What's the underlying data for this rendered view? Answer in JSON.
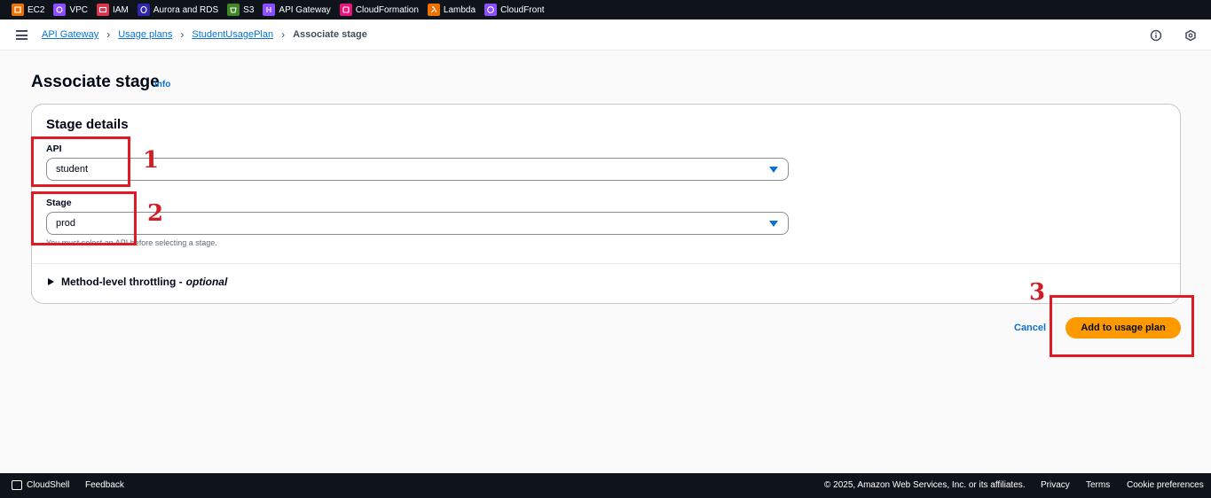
{
  "service_bar": {
    "items": [
      {
        "label": "EC2",
        "icon": "ec2-icon",
        "color": "#ed7100"
      },
      {
        "label": "VPC",
        "icon": "vpc-icon",
        "color": "#8c4fff"
      },
      {
        "label": "IAM",
        "icon": "iam-icon",
        "color": "#dd344c"
      },
      {
        "label": "Aurora and RDS",
        "icon": "rds-icon",
        "color": "#2e27ad"
      },
      {
        "label": "S3",
        "icon": "s3-icon",
        "color": "#3f8624"
      },
      {
        "label": "API Gateway",
        "icon": "api-gateway-icon",
        "color": "#8c4fff"
      },
      {
        "label": "CloudFormation",
        "icon": "cloudformation-icon",
        "color": "#e7157b"
      },
      {
        "label": "Lambda",
        "icon": "lambda-icon",
        "color": "#ed7100"
      },
      {
        "label": "CloudFront",
        "icon": "cloudfront-icon",
        "color": "#8c4fff"
      }
    ]
  },
  "breadcrumb": {
    "items": [
      "API Gateway",
      "Usage plans",
      "StudentUsagePlan"
    ],
    "current": "Associate stage"
  },
  "page": {
    "title": "Associate stage",
    "info_link": "Info"
  },
  "stage_details": {
    "title": "Stage details",
    "api_label": "API",
    "api_value": "student",
    "stage_label": "Stage",
    "stage_value": "prod",
    "stage_hint": "You must select an API before selecting a stage.",
    "throttling_label": "Method-level throttling -",
    "throttling_optional": "optional"
  },
  "actions": {
    "cancel": "Cancel",
    "submit": "Add to usage plan"
  },
  "annotations": [
    "1",
    "2",
    "3"
  ],
  "footer": {
    "cloudshell": "CloudShell",
    "feedback": "Feedback",
    "copyright": "© 2025, Amazon Web Services, Inc. or its affiliates.",
    "privacy": "Privacy",
    "terms": "Terms",
    "cookies": "Cookie preferences"
  },
  "colors": {
    "accent_link": "#0972d3",
    "primary_button": "#ff9900",
    "annotation_red": "#e01a24",
    "dark_bar": "#0f141a"
  }
}
